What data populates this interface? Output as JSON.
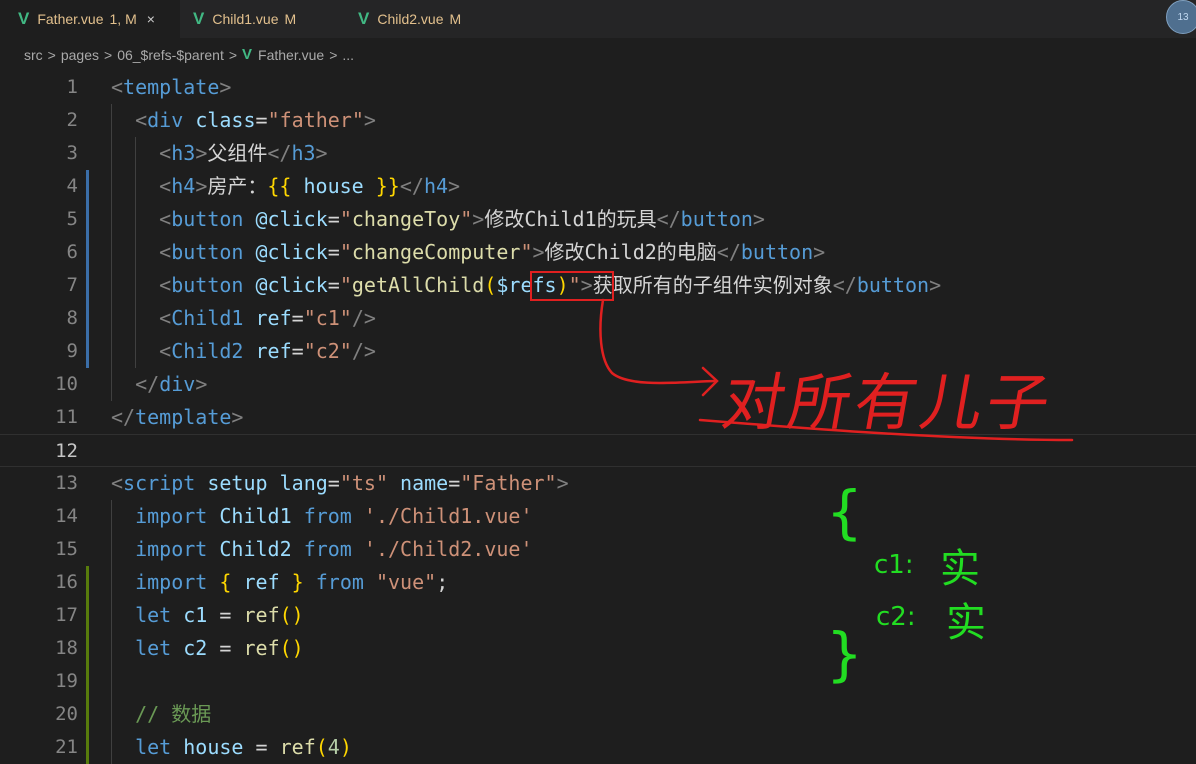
{
  "tabs": [
    {
      "icon": "V",
      "label": "Father.vue",
      "status": "1, M",
      "close": "×"
    },
    {
      "icon": "V",
      "label": "Child1.vue",
      "status": "M"
    },
    {
      "icon": "V",
      "label": "Child2.vue",
      "status": "M"
    }
  ],
  "avatar": {
    "text": "13"
  },
  "breadcrumb": {
    "items": [
      "src",
      "pages",
      "06_$refs-$parent"
    ],
    "file_icon": "V",
    "file": "Father.vue",
    "tail": "...",
    "separator": ">"
  },
  "lines": [
    {
      "n": "1",
      "tokens": [
        [
          "t",
          "<"
        ],
        [
          "tn",
          "template"
        ],
        [
          "t",
          ">"
        ]
      ]
    },
    {
      "n": "2",
      "tokens": [
        [
          "tx",
          "  "
        ],
        [
          "t",
          "<"
        ],
        [
          "tn",
          "div"
        ],
        [
          "tx",
          " "
        ],
        [
          "at",
          "class"
        ],
        [
          "tx",
          "="
        ],
        [
          "str",
          "\"father\""
        ],
        [
          "t",
          ">"
        ]
      ]
    },
    {
      "n": "3",
      "tokens": [
        [
          "tx",
          "    "
        ],
        [
          "t",
          "<"
        ],
        [
          "tn",
          "h3"
        ],
        [
          "t",
          ">"
        ],
        [
          "tx",
          "父组件"
        ],
        [
          "t",
          "</"
        ],
        [
          "tn",
          "h3"
        ],
        [
          "t",
          ">"
        ]
      ]
    },
    {
      "n": "4",
      "tokens": [
        [
          "tx",
          "    "
        ],
        [
          "t",
          "<"
        ],
        [
          "tn",
          "h4"
        ],
        [
          "t",
          ">"
        ],
        [
          "tx",
          "房产："
        ],
        [
          "br",
          "{{"
        ],
        [
          "tx",
          " "
        ],
        [
          "id",
          "house"
        ],
        [
          "tx",
          " "
        ],
        [
          "br",
          "}}"
        ],
        [
          "t",
          "</"
        ],
        [
          "tn",
          "h4"
        ],
        [
          "t",
          ">"
        ]
      ]
    },
    {
      "n": "5",
      "tokens": [
        [
          "tx",
          "    "
        ],
        [
          "t",
          "<"
        ],
        [
          "tn",
          "button"
        ],
        [
          "tx",
          " "
        ],
        [
          "at",
          "@click"
        ],
        [
          "tx",
          "="
        ],
        [
          "str",
          "\""
        ],
        [
          "fn",
          "changeToy"
        ],
        [
          "str",
          "\""
        ],
        [
          "t",
          ">"
        ],
        [
          "tx",
          "修改Child1的玩具"
        ],
        [
          "t",
          "</"
        ],
        [
          "tn",
          "button"
        ],
        [
          "t",
          ">"
        ]
      ]
    },
    {
      "n": "6",
      "tokens": [
        [
          "tx",
          "    "
        ],
        [
          "t",
          "<"
        ],
        [
          "tn",
          "button"
        ],
        [
          "tx",
          " "
        ],
        [
          "at",
          "@click"
        ],
        [
          "tx",
          "="
        ],
        [
          "str",
          "\""
        ],
        [
          "fn",
          "changeComputer"
        ],
        [
          "str",
          "\""
        ],
        [
          "t",
          ">"
        ],
        [
          "tx",
          "修改Child2的电脑"
        ],
        [
          "t",
          "</"
        ],
        [
          "tn",
          "button"
        ],
        [
          "t",
          ">"
        ]
      ]
    },
    {
      "n": "7",
      "tokens": [
        [
          "tx",
          "    "
        ],
        [
          "t",
          "<"
        ],
        [
          "tn",
          "button"
        ],
        [
          "tx",
          " "
        ],
        [
          "at",
          "@click"
        ],
        [
          "tx",
          "="
        ],
        [
          "str",
          "\""
        ],
        [
          "fn",
          "getAllChild"
        ],
        [
          "br",
          "("
        ],
        [
          "id",
          "$refs"
        ],
        [
          "br",
          ")"
        ],
        [
          "str",
          "\""
        ],
        [
          "t",
          ">"
        ],
        [
          "tx",
          "获取所有的子组件实例对象"
        ],
        [
          "t",
          "</"
        ],
        [
          "tn",
          "button"
        ],
        [
          "t",
          ">"
        ]
      ]
    },
    {
      "n": "8",
      "tokens": [
        [
          "tx",
          "    "
        ],
        [
          "t",
          "<"
        ],
        [
          "tn",
          "Child1"
        ],
        [
          "tx",
          " "
        ],
        [
          "at",
          "ref"
        ],
        [
          "tx",
          "="
        ],
        [
          "str",
          "\"c1\""
        ],
        [
          "t",
          "/>"
        ]
      ]
    },
    {
      "n": "9",
      "tokens": [
        [
          "tx",
          "    "
        ],
        [
          "t",
          "<"
        ],
        [
          "tn",
          "Child2"
        ],
        [
          "tx",
          " "
        ],
        [
          "at",
          "ref"
        ],
        [
          "tx",
          "="
        ],
        [
          "str",
          "\"c2\""
        ],
        [
          "t",
          "/>"
        ]
      ]
    },
    {
      "n": "10",
      "tokens": [
        [
          "tx",
          "  "
        ],
        [
          "t",
          "</"
        ],
        [
          "tn",
          "div"
        ],
        [
          "t",
          ">"
        ]
      ]
    },
    {
      "n": "11",
      "tokens": [
        [
          "t",
          "</"
        ],
        [
          "tn",
          "template"
        ],
        [
          "t",
          ">"
        ]
      ]
    },
    {
      "n": "12",
      "tokens": []
    },
    {
      "n": "13",
      "tokens": [
        [
          "t",
          "<"
        ],
        [
          "tn",
          "script"
        ],
        [
          "tx",
          " "
        ],
        [
          "at",
          "setup"
        ],
        [
          "tx",
          " "
        ],
        [
          "at",
          "lang"
        ],
        [
          "tx",
          "="
        ],
        [
          "str",
          "\"ts\""
        ],
        [
          "tx",
          " "
        ],
        [
          "at",
          "name"
        ],
        [
          "tx",
          "="
        ],
        [
          "str",
          "\"Father\""
        ],
        [
          "t",
          ">"
        ]
      ]
    },
    {
      "n": "14",
      "tokens": [
        [
          "tx",
          "  "
        ],
        [
          "kw",
          "import"
        ],
        [
          "tx",
          " "
        ],
        [
          "id",
          "Child1"
        ],
        [
          "tx",
          " "
        ],
        [
          "kw",
          "from"
        ],
        [
          "tx",
          " "
        ],
        [
          "str",
          "'./Child1.vue'"
        ]
      ]
    },
    {
      "n": "15",
      "tokens": [
        [
          "tx",
          "  "
        ],
        [
          "kw",
          "import"
        ],
        [
          "tx",
          " "
        ],
        [
          "id",
          "Child2"
        ],
        [
          "tx",
          " "
        ],
        [
          "kw",
          "from"
        ],
        [
          "tx",
          " "
        ],
        [
          "str",
          "'./Child2.vue'"
        ]
      ]
    },
    {
      "n": "16",
      "tokens": [
        [
          "tx",
          "  "
        ],
        [
          "kw",
          "import"
        ],
        [
          "tx",
          " "
        ],
        [
          "br",
          "{"
        ],
        [
          "tx",
          " "
        ],
        [
          "id",
          "ref"
        ],
        [
          "tx",
          " "
        ],
        [
          "br",
          "}"
        ],
        [
          "tx",
          " "
        ],
        [
          "kw",
          "from"
        ],
        [
          "tx",
          " "
        ],
        [
          "str",
          "\"vue\""
        ],
        [
          "tx",
          ";"
        ]
      ]
    },
    {
      "n": "17",
      "tokens": [
        [
          "tx",
          "  "
        ],
        [
          "kw",
          "let"
        ],
        [
          "tx",
          " "
        ],
        [
          "id",
          "c1"
        ],
        [
          "tx",
          " = "
        ],
        [
          "fn",
          "ref"
        ],
        [
          "br",
          "()"
        ]
      ]
    },
    {
      "n": "18",
      "tokens": [
        [
          "tx",
          "  "
        ],
        [
          "kw",
          "let"
        ],
        [
          "tx",
          " "
        ],
        [
          "id",
          "c2"
        ],
        [
          "tx",
          " = "
        ],
        [
          "fn",
          "ref"
        ],
        [
          "br",
          "()"
        ]
      ]
    },
    {
      "n": "19",
      "tokens": []
    },
    {
      "n": "20",
      "tokens": [
        [
          "tx",
          "  "
        ],
        [
          "cm",
          "// 数据"
        ]
      ]
    },
    {
      "n": "21",
      "tokens": [
        [
          "tx",
          "  "
        ],
        [
          "kw",
          "let"
        ],
        [
          "tx",
          " "
        ],
        [
          "id",
          "house"
        ],
        [
          "tx",
          " = "
        ],
        [
          "fn",
          "ref"
        ],
        [
          "br",
          "("
        ],
        [
          "num",
          "4"
        ],
        [
          "br",
          ")"
        ]
      ]
    }
  ],
  "current_line": "12",
  "annotations": {
    "arrow_note": "对所有儿子",
    "brace_open": "{",
    "brace_close": "}",
    "c1_key": "c1:",
    "c1_val": "实",
    "c2_key": "c2:",
    "c2_val": "实",
    "colors": {
      "red": "#e02020",
      "green": "#22dd22"
    }
  }
}
